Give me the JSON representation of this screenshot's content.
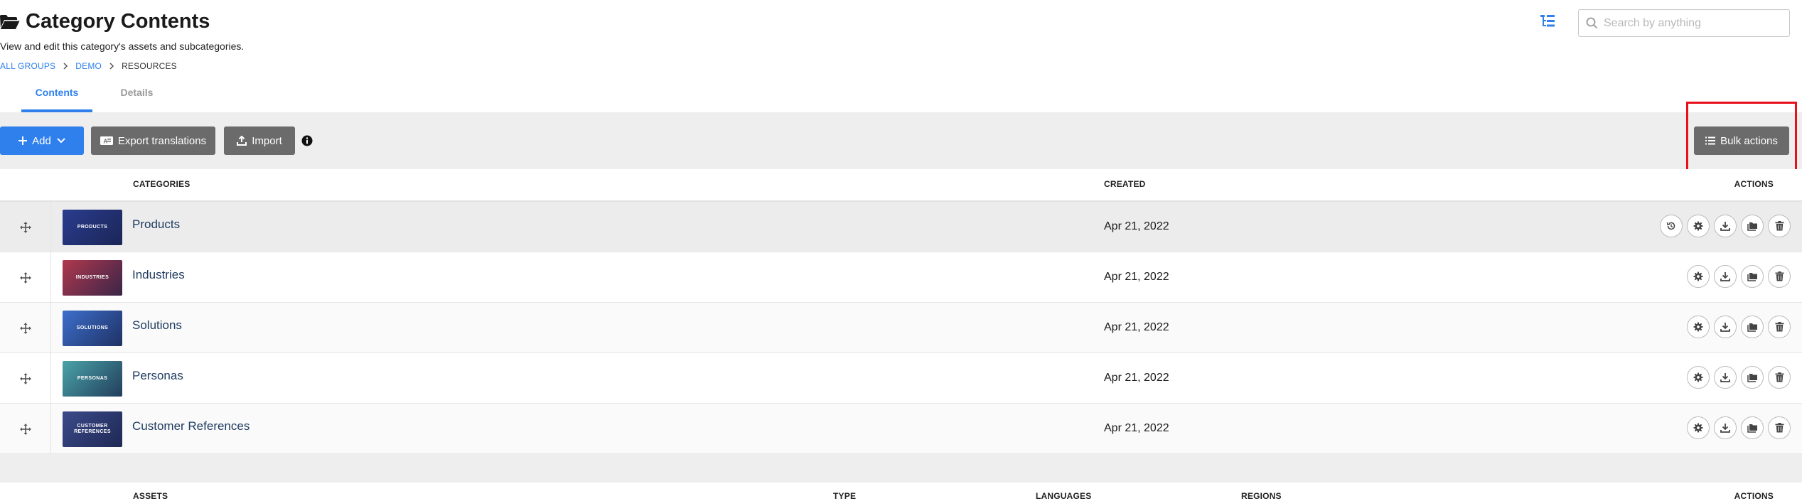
{
  "header": {
    "title": "Category Contents",
    "subtitle": "View and edit this category's assets and subcategories.",
    "breadcrumb": [
      {
        "label": "ALL GROUPS"
      },
      {
        "label": "DEMO"
      },
      {
        "label": "RESOURCES"
      }
    ]
  },
  "search": {
    "placeholder": "Search by anything",
    "value": ""
  },
  "tabs": [
    {
      "label": "Contents",
      "active": true
    },
    {
      "label": "Details",
      "active": false
    }
  ],
  "toolbar": {
    "add_label": "Add",
    "export_label": "Export translations",
    "import_label": "Import",
    "bulk_label": "Bulk actions"
  },
  "categories_table": {
    "columns": {
      "name": "CATEGORIES",
      "created": "CREATED",
      "actions": "ACTIONS"
    },
    "rows": [
      {
        "name": "Products",
        "thumb_text": "PRODUCTS",
        "thumb_color": "#2a3c8f",
        "created": "Apr 21, 2022",
        "actions": [
          "history-icon",
          "gear-icon",
          "download-icon",
          "folders-icon",
          "trash-icon"
        ]
      },
      {
        "name": "Industries",
        "thumb_text": "INDUSTRIES",
        "thumb_color": "#b0384e",
        "created": "Apr 21, 2022",
        "actions": [
          "gear-icon",
          "download-icon",
          "folders-icon",
          "trash-icon"
        ]
      },
      {
        "name": "Solutions",
        "thumb_text": "SOLUTIONS",
        "thumb_color": "#3d6fcc",
        "created": "Apr 21, 2022",
        "actions": [
          "gear-icon",
          "download-icon",
          "folders-icon",
          "trash-icon"
        ]
      },
      {
        "name": "Personas",
        "thumb_text": "PERSONAS",
        "thumb_color": "#4aa3a8",
        "created": "Apr 21, 2022",
        "actions": [
          "gear-icon",
          "download-icon",
          "folders-icon",
          "trash-icon"
        ]
      },
      {
        "name": "Customer References",
        "thumb_text": "CUSTOMER REFERENCES",
        "thumb_color": "#3b4a8a",
        "created": "Apr 21, 2022",
        "actions": [
          "gear-icon",
          "download-icon",
          "folders-icon",
          "trash-icon"
        ]
      }
    ]
  },
  "assets_table": {
    "columns": {
      "name": "ASSETS",
      "type": "TYPE",
      "languages": "LANGUAGES",
      "regions": "REGIONS",
      "actions": "ACTIONS"
    }
  },
  "colors": {
    "accent": "#2f80ed",
    "button_gray": "#6b6b6b",
    "toolbar_bg": "#eeeeee",
    "highlight": "#e8101a",
    "link_dark": "#1e3a5f"
  }
}
